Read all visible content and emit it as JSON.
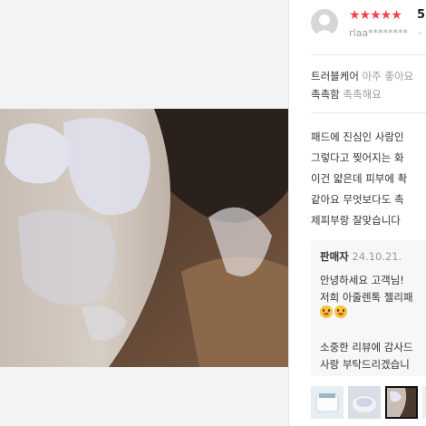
{
  "review": {
    "stars": "★★★★★",
    "rating": "5",
    "reviewer": "rlaa********",
    "separator": "·",
    "options": [
      {
        "key": "트러블케어",
        "value": "아주 좋아요"
      },
      {
        "key": "촉촉함",
        "value": "촉촉해요"
      }
    ],
    "body_lines": [
      "패드에 진심인 사람인",
      "그렇다고 찢어지는 화",
      "이건 얇은데 피부에 촥",
      "같아요 무엇보다도 촉",
      "제피부랑 잘맞습니다"
    ]
  },
  "seller_reply": {
    "name": "판매자",
    "date": "24.10.21.",
    "lines": [
      "안녕하세요 고객님!",
      "저희 아줄렌톡 젤리패",
      "",
      "소중한 리뷰에 감사드",
      "사랑 부탁드리겠습니"
    ],
    "emoji_count": 2
  },
  "thumbnails": {
    "count": 4,
    "selected_index": 2
  },
  "colors": {
    "star": "#f0434d",
    "muted": "#9a9a9a",
    "text": "#333333",
    "reply_bg": "#f6f7f8",
    "panel_bg": "#f2f3f5"
  }
}
